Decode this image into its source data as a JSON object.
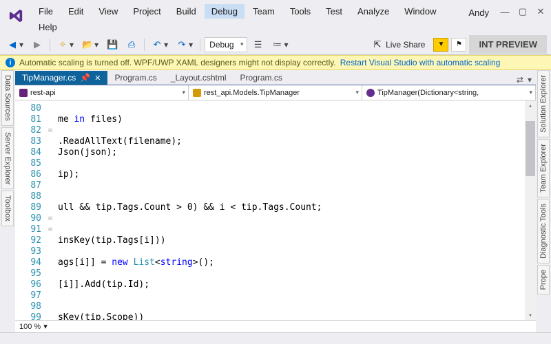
{
  "menus": [
    "File",
    "Edit",
    "View",
    "Project",
    "Build",
    "Debug",
    "Team",
    "Tools",
    "Test",
    "Analyze",
    "Window",
    "Help"
  ],
  "highlighted_menu": "Debug",
  "user": "Andy",
  "toolbar": {
    "config": "Debug",
    "live_share": "Live Share",
    "preview": "INT PREVIEW"
  },
  "infobar": {
    "text": "Automatic scaling is turned off. WPF/UWP XAML designers might not display correctly.",
    "link": "Restart Visual Studio with automatic scaling"
  },
  "left_panels": [
    "Data Sources",
    "Server Explorer",
    "Toolbox"
  ],
  "right_panels": [
    "Solution Explorer",
    "Team Explorer",
    "Diagnostic Tools",
    "Prope"
  ],
  "doc_tabs": {
    "active": "TipManager.cs",
    "others": [
      "Program.cs",
      "_Layout.cshtml",
      "Program.cs"
    ],
    "extra": "⇄"
  },
  "nav": {
    "scope1": "rest-api",
    "scope2": "rest_api.Models.TipManager",
    "scope3": "TipManager(Dictionary<string,"
  },
  "code": {
    "start": 80,
    "lines": [
      "",
      "me in files)",
      "",
      ".ReadAllText(filename);",
      "Json(json);",
      "",
      "ip);",
      "",
      "",
      "ull && tip.Tags.Count > 0) && i < tip.Tags.Count;",
      "",
      "",
      "insKey(tip.Tags[i]))",
      "",
      "ags[i]] = new List<string>();",
      "",
      "[i]].Add(tip.Id);",
      "",
      "",
      "sKev(tip.Scope))"
    ],
    "fold_at": [
      82,
      90,
      91
    ]
  },
  "zoom": "100 %"
}
